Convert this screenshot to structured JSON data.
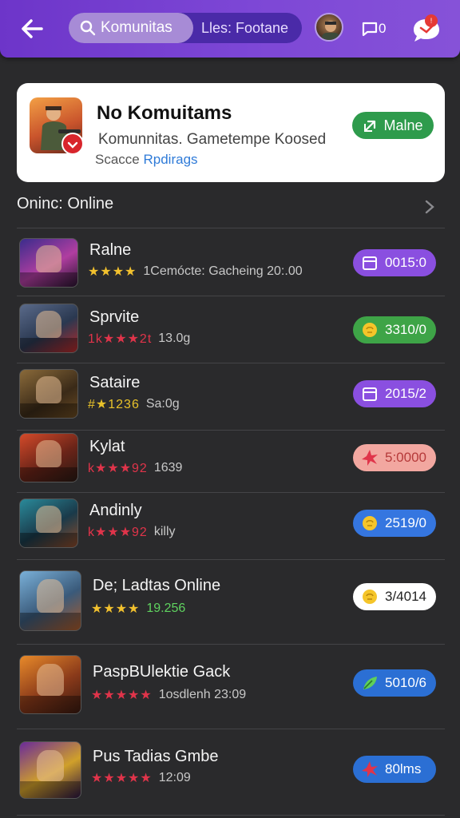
{
  "topbar": {
    "search_label": "Komunitas",
    "filter_label": "Lles: Footane",
    "messages_count": "0",
    "notification_count": "!"
  },
  "card": {
    "title": "No Komuitams",
    "subtitle": "Komunnitas. Gametempe Koosed",
    "meta_prefix": "Scacce",
    "meta_link": "Rpdirags",
    "join_label": "Malne"
  },
  "section": {
    "title": "Oninc: Online"
  },
  "games": [
    {
      "title": "Ralne",
      "stars": "★★★★",
      "meta": "1Cemócte: Gacheing 20:.00",
      "badge": "0015:0",
      "badge_icon": "calendar-icon",
      "badge_color": "#8a4fe0"
    },
    {
      "title": "Sprvite",
      "stars": "1k★★★2t",
      "meta": "13.0g",
      "badge": "3310/0",
      "badge_icon": "coin-icon",
      "badge_color": "#3ea447"
    },
    {
      "title": "Sataire",
      "stars": "#★1236",
      "meta": "Sa:0g",
      "badge": "2015/2",
      "badge_icon": "calendar-icon",
      "badge_color": "#8a4fe0"
    },
    {
      "title": "Kylat",
      "stars": "k★★★92",
      "meta": "1639",
      "badge": "5:0000",
      "badge_icon": "burst-icon",
      "badge_color": "#f2a7a0"
    },
    {
      "title": "Andinly",
      "stars": "k★★★92",
      "meta": "killy",
      "badge": "2519/0",
      "badge_icon": "coin-icon",
      "badge_color": "#3576e0"
    },
    {
      "title": "De; Ladtas Online",
      "stars": "★★★★",
      "meta": "19.256",
      "badge": "3/4014",
      "badge_icon": "coin-icon",
      "badge_color": "#ffffff"
    },
    {
      "title": "PaspBUlektie Gack",
      "stars": "★★★★★",
      "meta": "1osdlenh 23:09",
      "badge": "5010/6",
      "badge_icon": "leaf-icon",
      "badge_color": "#2b6fd4"
    },
    {
      "title": "Pus Tadias Gmbe",
      "stars": "★★★★★",
      "meta": "12:09",
      "badge": "80lms",
      "badge_icon": "burst-icon",
      "badge_color": "#2b6fd4"
    }
  ],
  "colors": {
    "topbar_accent": "#7b46d6",
    "background": "#2a2a2c",
    "join_green": "#2e9b4c",
    "link_blue": "#2f7bd8",
    "star_gold": "#f2c12e",
    "star_red": "#e0344a"
  }
}
